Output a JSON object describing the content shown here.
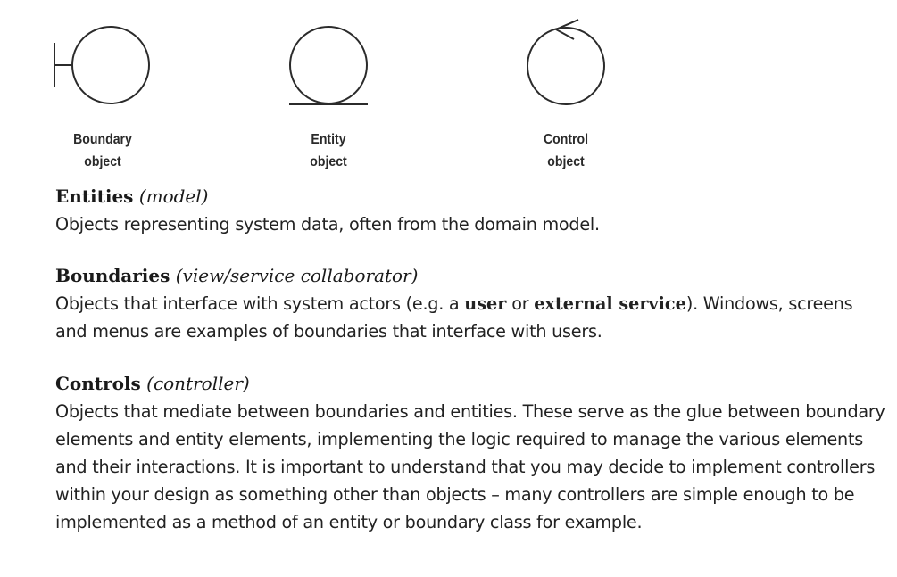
{
  "diagram": {
    "boundary": {
      "line1": "Boundary",
      "line2": "object"
    },
    "entity": {
      "line1": "Entity",
      "line2": "object"
    },
    "control": {
      "line1": "Control",
      "line2": "object"
    }
  },
  "entities": {
    "term": "Entities",
    "role": "(model)",
    "text": "Objects representing system data, often from the domain model."
  },
  "boundaries": {
    "term": "Boundaries",
    "role": "(view/service collaborator)",
    "text_part1": "Objects that interface with system actors (e.g. a ",
    "bold1": "user",
    "text_part2": " or ",
    "bold2": "external service",
    "text_part3": "). Windows, screens and menus are examples of boundaries that interface with users."
  },
  "controls": {
    "term": "Controls",
    "role": "(controller)",
    "text": "Objects that mediate between boundaries and entities. These serve as the glue between boundary elements and entity elements, implementing the logic required to manage the various elements and their interactions. It is important to understand that you may decide to implement controllers within your design as something other than objects – many controllers are simple enough to be implemented as a method of an entity or boundary class for example."
  }
}
